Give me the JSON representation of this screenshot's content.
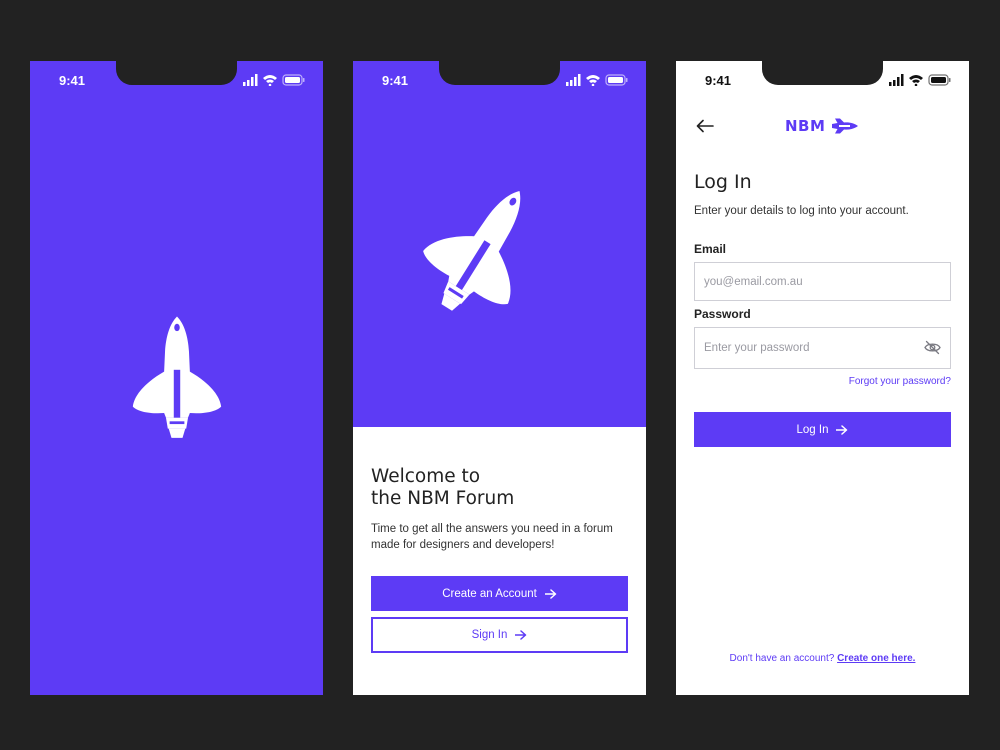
{
  "colors": {
    "accent": "#5d3bf5",
    "background": "#222222",
    "surface": "#ffffff"
  },
  "status_bar": {
    "time": "9:41"
  },
  "splash": {
    "logo_icon": "rocket-icon"
  },
  "welcome": {
    "hero_icon": "rocket-icon",
    "title": "Welcome to\nthe NBM Forum",
    "subtitle": "Time to get all the answers you need in a forum made for designers and developers!",
    "create_account_label": "Create an Account",
    "sign_in_label": "Sign In"
  },
  "login": {
    "brand": "NBM",
    "title": "Log In",
    "subtitle": "Enter your details to log into your account.",
    "email_label": "Email",
    "email_placeholder": "you@email.com.au",
    "password_label": "Password",
    "password_placeholder": "Enter your password",
    "forgot_label": "Forgot your password?",
    "login_button": "Log In",
    "no_account_text": "Don't have an account?",
    "create_link": "Create one here."
  }
}
